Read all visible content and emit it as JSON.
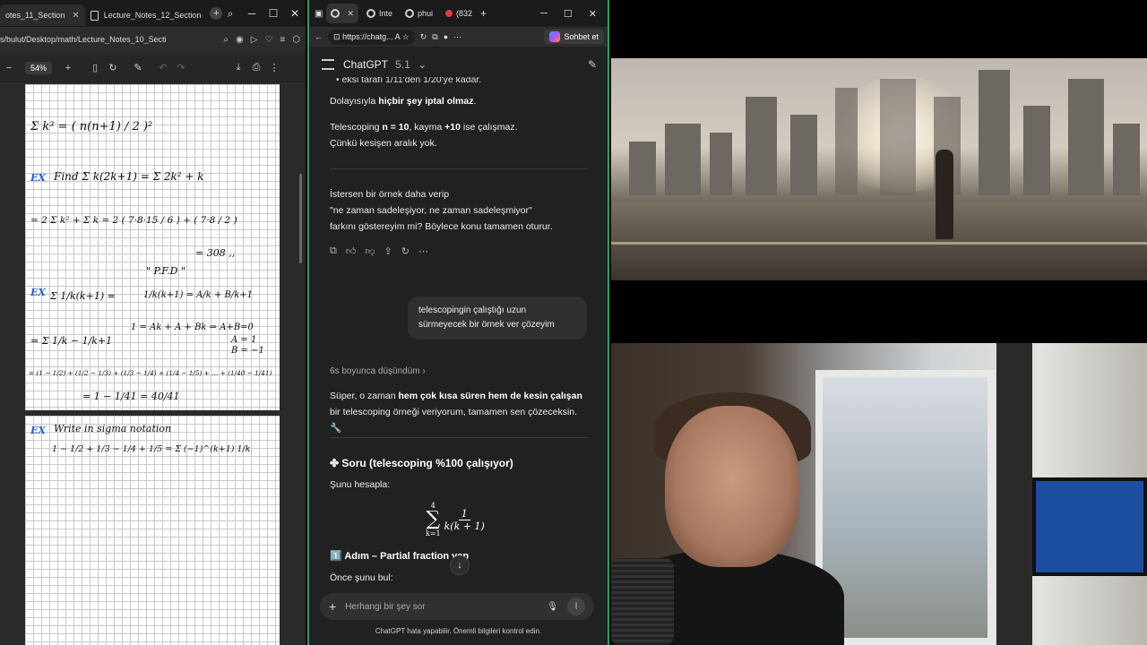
{
  "pdf_window": {
    "tabs": [
      {
        "label": "otes_11_Section"
      },
      {
        "label": "Lecture_Notes_12_Section"
      }
    ],
    "address": "s/bulut/Desktop/math/Lecture_Notes_10_Secti",
    "zoom": "54%",
    "handwriting": {
      "sum_k3": "Σ k³ = ( n(n+1) / 2 )²",
      "ex1_label": "EX",
      "ex1_line1": "Find  Σ k(2k+1) = Σ 2k² + k",
      "ex1_line2": "= 2 Σ k² + Σ k = 2 ( 7·8·15 / 6 ) + ( 7·8 / 2 )",
      "ex1_result": "= 308 ,,",
      "pfd": "\" P.F.D \"",
      "ex2_label": "EX",
      "ex2_line1": "Σ 1/k(k+1) =",
      "ex2_pfd": "1/k(k+1) = A/k + B/k+1",
      "ex2_system": "1 = Ak + A + Bk ⇒ A+B=0",
      "ex2_a": "A = 1",
      "ex2_b": "B = −1",
      "ex2_line2": "= Σ 1/k − 1/k+1",
      "ex2_telescope": "= (1 − 1/2) + (1/2 − 1/3) + (1/3 − 1/4) + (1/4 − 1/5) + … + (1/40 − 1/41)",
      "ex2_result": "= 1 − 1/41 = 40/41",
      "ex3_label": "EX",
      "ex3_line1": "Write in sigma notation",
      "ex3_line2": "1 − 1/2 + 1/3 − 1/4 + 1/5  =  Σ (−1)^(k+1) 1/k"
    }
  },
  "gpt_window": {
    "tabs": [
      {
        "label": ""
      },
      {
        "label": "Inte"
      },
      {
        "label": "phui"
      },
      {
        "label": "(832"
      }
    ],
    "url": "https://chatg...",
    "copilot_label": "Sohbet et",
    "app_title": "ChatGPT",
    "model_version": "5.1",
    "messages": {
      "top_bullet": "eksi tarafı 1/11'den 1/20'ye kadar.",
      "line1_prefix": "Dolayısıyla ",
      "line1_bold": "hiçbir şey iptal olmaz",
      "line1_suffix": ".",
      "line2_a": "Telescoping ",
      "line2_b": "n = 10",
      "line2_c": ", kayma ",
      "line2_d": "+10",
      "line2_e": " ise çalışmaz.",
      "line3": "Çünkü kesişen aralık yok.",
      "offer_1": "İstersen bir örnek daha verip",
      "offer_2": "\"ne zaman sadeleşiyor, ne zaman sadeleşmiyor\"",
      "offer_3": "farkını göstereyim mi? Böylece konu tamamen oturur.",
      "user_msg": "telescopingin çalıştığı uzun sürmeyecek bir örnek ver çözeyim",
      "thought": "6s boyunca düşündüm",
      "reply_a": "Süper, o zaman ",
      "reply_b": "hem çok kısa süren hem de kesin çalışan",
      "reply_c": " bir telescoping örneği veriyorum, tamamen sen çözeceksin. 🔧",
      "question_title": "✤ Soru (telescoping %100 çalışıyor)",
      "compute": "Şunu hesapla:",
      "sum_upper": "4",
      "sum_lower": "k=1",
      "sum_num": "1",
      "sum_den": "k(k + 1)",
      "step1": "1️⃣ Adım – Partial fraction yap",
      "step1_sub": "Önce şunu bul:"
    },
    "composer_placeholder": "Herhangi bir şey sor",
    "disclaimer": "ChatGPT hata yapabilir. Önemli bilgileri kontrol edin."
  },
  "colors": {
    "accent_green": "#2f9e5b",
    "ex_blue": "#2b5fd1"
  }
}
